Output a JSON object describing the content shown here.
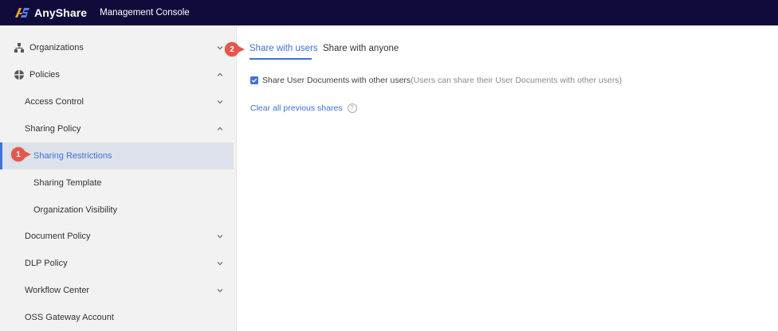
{
  "header": {
    "brand": "AnyShare",
    "console_title": "Management Console",
    "colors": {
      "bar": "#0f0c3b",
      "logo_a": "#f0a42a",
      "logo_s": "#5a7fe8"
    }
  },
  "sidebar": {
    "items": [
      {
        "label": "Organizations",
        "icon": "org-chart-icon",
        "chevron": "down"
      },
      {
        "label": "Policies",
        "icon": "shield-icon",
        "chevron": "up"
      },
      {
        "label": "Access Control",
        "chevron": "down"
      },
      {
        "label": "Sharing Policy",
        "chevron": "up"
      },
      {
        "label": "Sharing Restrictions",
        "active": true
      },
      {
        "label": "Sharing Template"
      },
      {
        "label": "Organization Visibility"
      },
      {
        "label": "Document Policy",
        "chevron": "down"
      },
      {
        "label": "DLP Policy",
        "chevron": "down"
      },
      {
        "label": "Workflow Center",
        "chevron": "down"
      },
      {
        "label": "OSS Gateway Account"
      }
    ]
  },
  "main": {
    "tabs": [
      {
        "label": "Share with users",
        "active": true
      },
      {
        "label": "Share with anyone"
      }
    ],
    "option": {
      "checked": true,
      "label": "Share User Documents with other users",
      "hint": "(Users can share their User Documents with other users)"
    },
    "clear_link": "Clear all previous shares",
    "help_glyph": "?"
  },
  "markers": [
    {
      "number": "1",
      "target": "Sharing Restrictions"
    },
    {
      "number": "2",
      "target": "Share with users"
    }
  ],
  "accent_color": "#3d72d9",
  "marker_color": "#e4574a"
}
